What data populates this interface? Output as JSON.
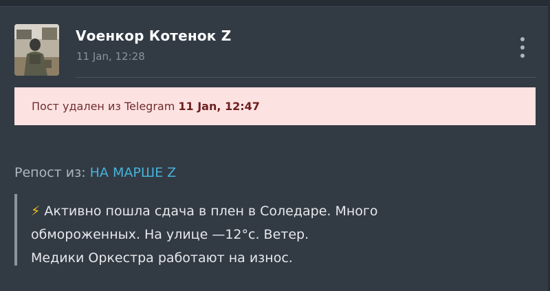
{
  "post": {
    "author_name": "Vоенкор Котенок Z",
    "time": "11 Jan, 12:28",
    "menu_icon": "more-vertical-icon"
  },
  "deleted_banner": {
    "text": "Пост удален из Telegram ",
    "date": "11 Jan, 12:47"
  },
  "repost": {
    "prefix": "Репост из: ",
    "channel": "НА МАРШЕ Z"
  },
  "quote": {
    "icon": "⚡",
    "line1": " Активно пошла сдача в плен в Соледаре. Много",
    "line2": "обмороженных. На улице —12°с. Ветер.",
    "line3": "Медики Оркестра работают на износ."
  },
  "colors": {
    "background": "#272d35",
    "card": "#323a44",
    "banner": "#fde2e2",
    "link": "#45b4dc",
    "zap": "#f5c518"
  }
}
